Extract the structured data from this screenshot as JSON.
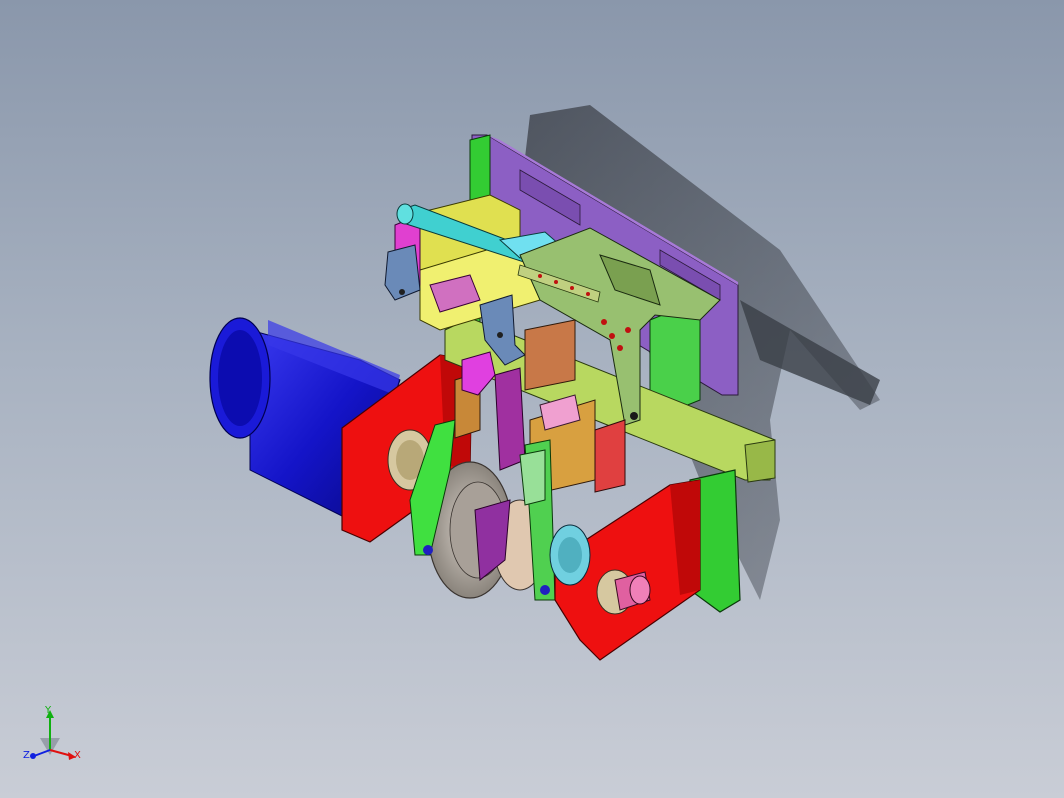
{
  "viewport": {
    "description_colors": {
      "background_top": "#8a97ab",
      "background_bottom": "#c9cdd6"
    }
  },
  "model": {
    "parts": [
      {
        "name": "back-plate",
        "color": "#8c5fc4"
      },
      {
        "name": "motor",
        "color": "#1414d8"
      },
      {
        "name": "side-plate-left",
        "color": "#ee1010"
      },
      {
        "name": "side-plate-right",
        "color": "#ee1010"
      },
      {
        "name": "base-block",
        "color": "#33cc33"
      },
      {
        "name": "slide-rail",
        "color": "#b8d860"
      },
      {
        "name": "cylinder-block",
        "color": "#e0e050"
      },
      {
        "name": "guide-rod",
        "color": "#40d0d0"
      },
      {
        "name": "bracket-plate",
        "color": "#98c070"
      },
      {
        "name": "cam-disc",
        "color": "#b8b0a8"
      },
      {
        "name": "output-shaft",
        "color": "#e060a0"
      }
    ]
  },
  "triad": {
    "x_label": "X",
    "y_label": "Y",
    "z_label": "Z",
    "x_color": "#e01010",
    "y_color": "#10b010",
    "z_color": "#1020e0"
  }
}
